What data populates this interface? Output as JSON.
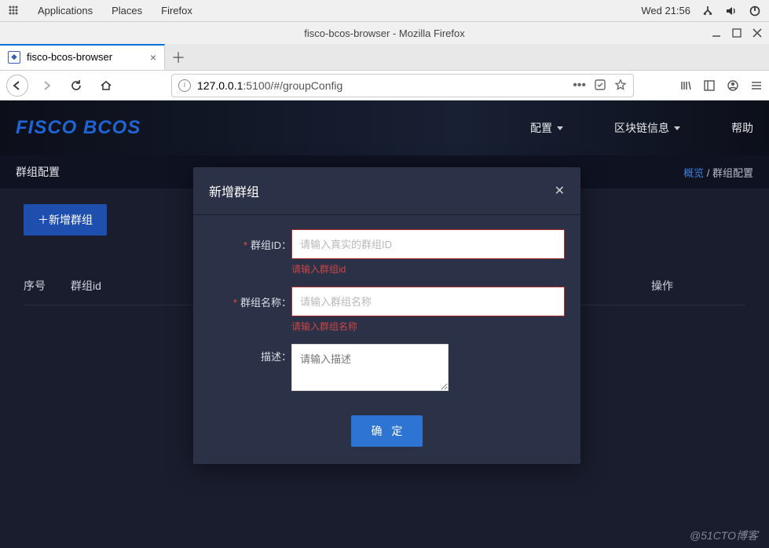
{
  "gnome": {
    "applications": "Applications",
    "places": "Places",
    "firefox": "Firefox",
    "clock": "Wed 21:56"
  },
  "firefox": {
    "windowTitle": "fisco-bcos-browser - Mozilla Firefox",
    "tab": {
      "title": "fisco-bcos-browser"
    },
    "url": {
      "host": "127.0.0.1",
      "path": ":5100/#/groupConfig"
    }
  },
  "app": {
    "logo": "FISCO BCOS",
    "menu": {
      "config": "配置",
      "blockchain": "区块链信息",
      "help": "帮助"
    },
    "crumb": {
      "title": "群组配置",
      "link": "概览",
      "sep": " / ",
      "current": "群组配置"
    },
    "addBtn": "＋新增群组",
    "table": {
      "seq": "序号",
      "groupId": "群组id",
      "op": "操作"
    }
  },
  "modal": {
    "title": "新增群组",
    "groupId": {
      "label": "群组ID：",
      "placeholder": "请输入真实的群组ID",
      "error": "请输入群组id"
    },
    "groupName": {
      "label": "群组名称：",
      "placeholder": "请输入群组名称",
      "error": "请输入群组名称"
    },
    "desc": {
      "label": "描述：",
      "placeholder": "请输入描述"
    },
    "ok": "确 定"
  },
  "watermark": "@51CTO博客"
}
